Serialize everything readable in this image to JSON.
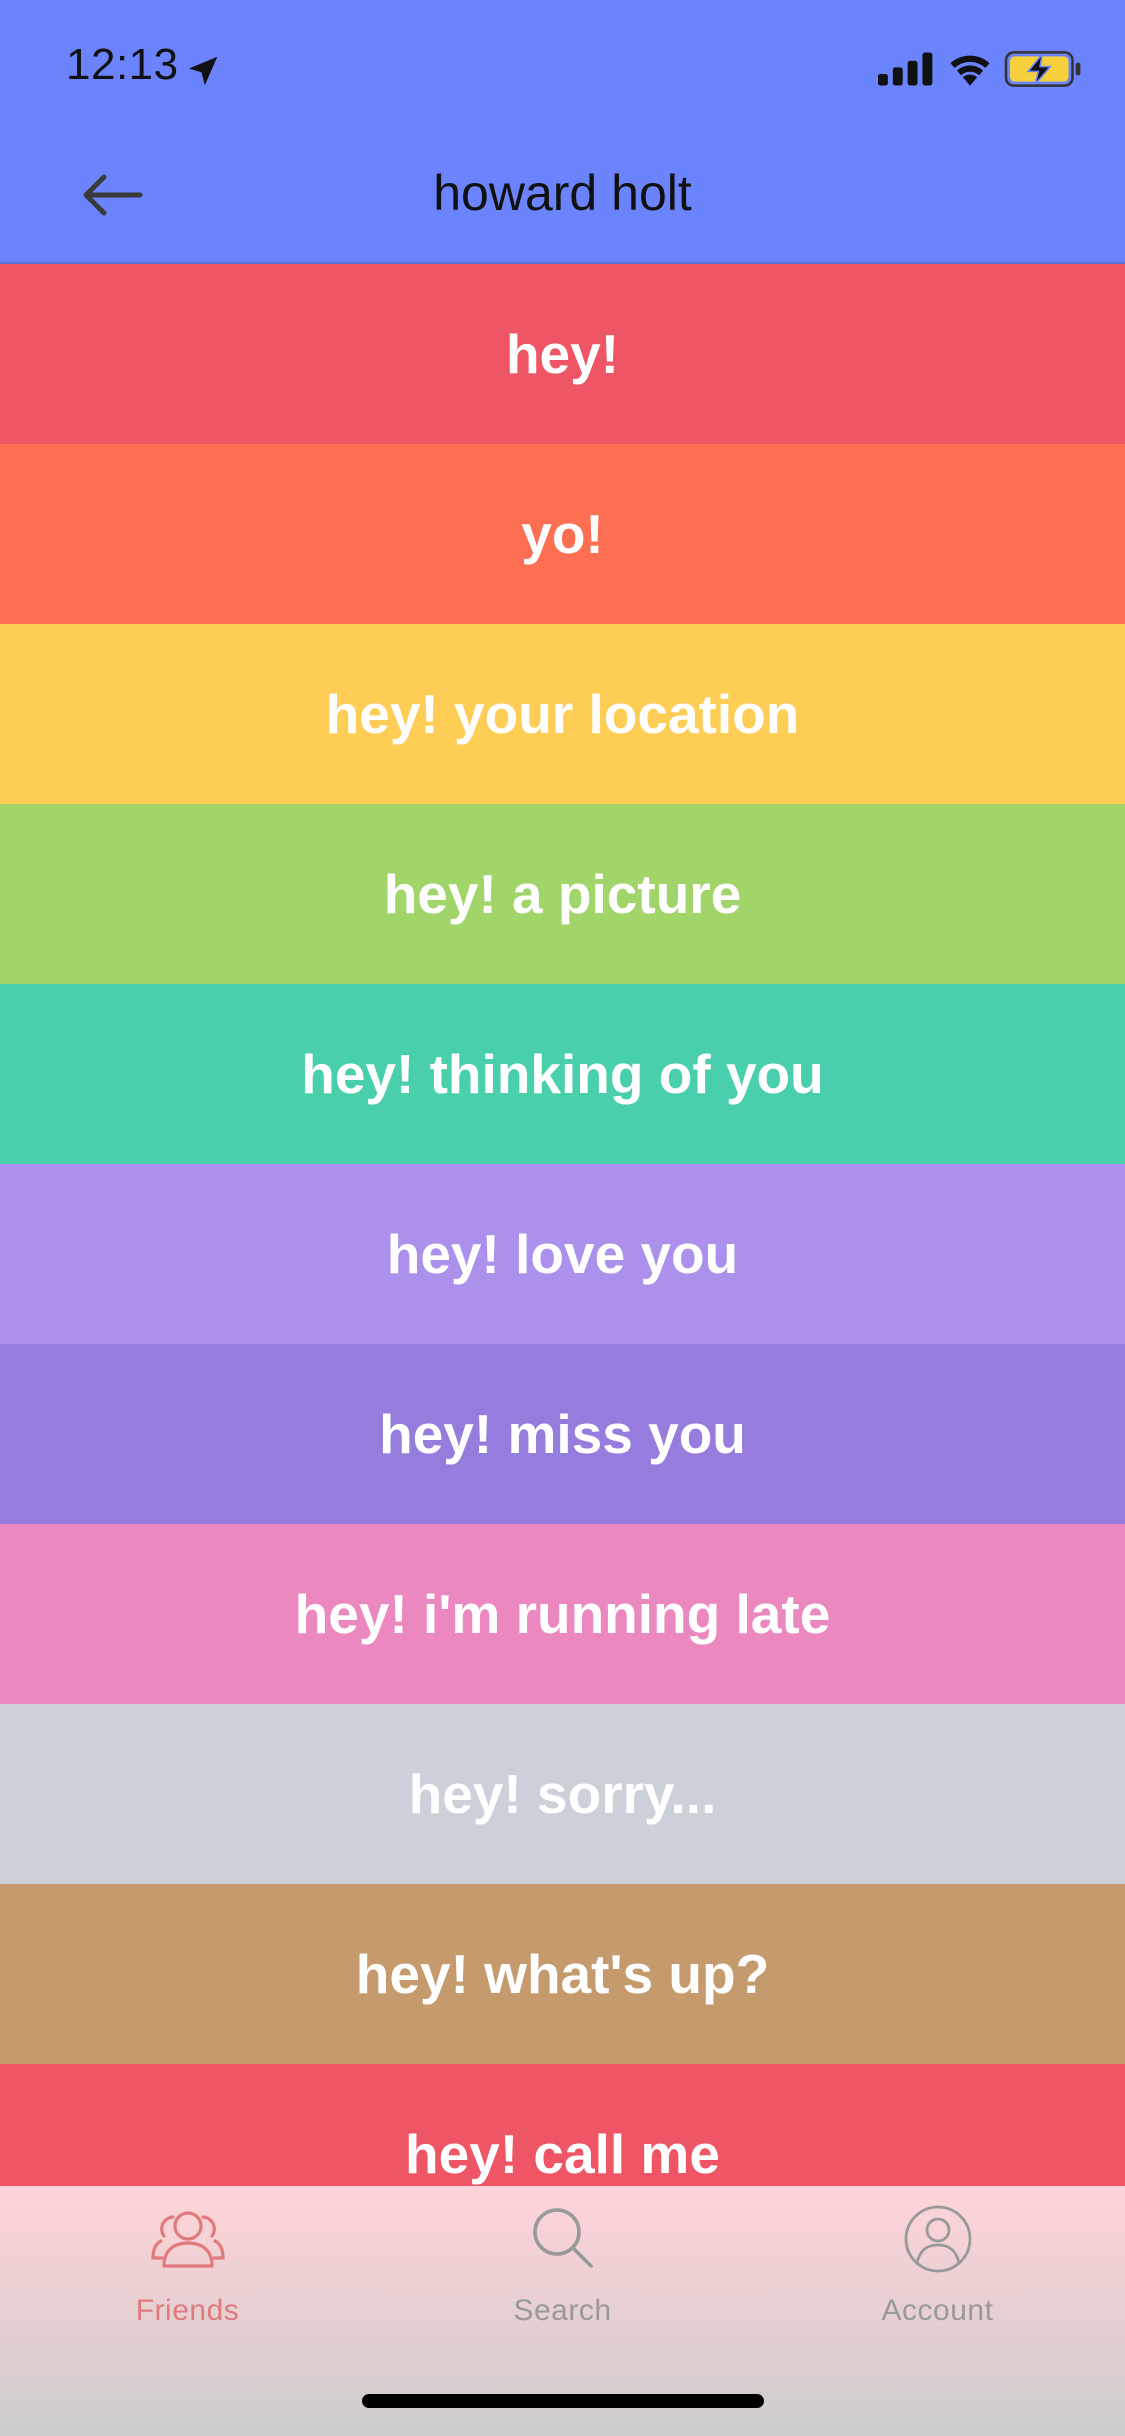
{
  "status_bar": {
    "time": "12:13",
    "icons": [
      "location-arrow-icon",
      "signal-icon",
      "wifi-icon",
      "battery-charging-icon"
    ]
  },
  "nav": {
    "back_icon": "arrow-left-icon",
    "title": "howard holt"
  },
  "colors": {
    "header": "#6b84fe",
    "tab_active": "#e07a7f",
    "tab_inactive": "#999999"
  },
  "messages": [
    {
      "label": "hey!",
      "color": "#ee5565"
    },
    {
      "label": "yo!",
      "color": "#fd6f53"
    },
    {
      "label": "hey! your location",
      "color": "#fecd55"
    },
    {
      "label": "hey! a picture",
      "color": "#a1d56a"
    },
    {
      "label": "hey! thinking of you",
      "color": "#4acfad"
    },
    {
      "label": "hey! love you",
      "color": "#ab90ec"
    },
    {
      "label": "hey! miss you",
      "color": "#967cdd"
    },
    {
      "label": "hey! i'm running late",
      "color": "#ec88c0"
    },
    {
      "label": "hey! sorry...",
      "color": "#ccd0d9"
    },
    {
      "label": "hey! what's up?",
      "color": "#c59b6e"
    },
    {
      "label": "hey! call me",
      "color": "#ee5565"
    }
  ],
  "tabs": [
    {
      "label": "Friends",
      "icon": "friends-icon",
      "active": true
    },
    {
      "label": "Search",
      "icon": "search-icon",
      "active": false
    },
    {
      "label": "Account",
      "icon": "account-icon",
      "active": false
    }
  ]
}
